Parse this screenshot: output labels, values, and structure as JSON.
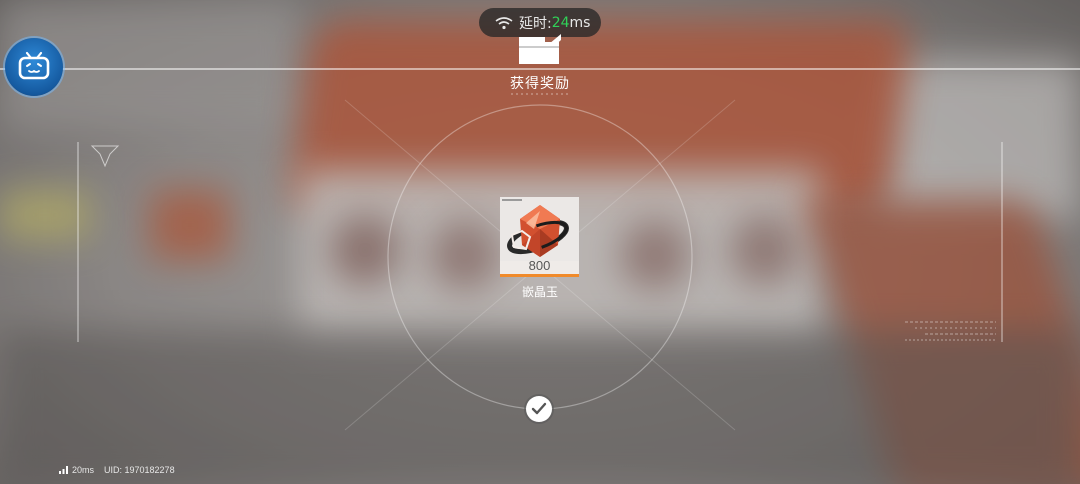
{
  "network": {
    "latency_label": "延时:",
    "latency_value": "24",
    "latency_unit": "ms",
    "footer_ping": "20ms",
    "uid": "UID: 1970182278"
  },
  "reward": {
    "title": "获得奖励",
    "item": {
      "name": "嵌晶玉",
      "count": "800"
    }
  },
  "icons": {
    "wifi": "wifi-icon",
    "bilibili": "bilibili-tv-icon",
    "reward_box": "reward-box-icon",
    "confirm": "checkmark-icon",
    "signal": "signal-bars-icon"
  },
  "colors": {
    "latency_good": "#30d158",
    "rarity_bar": "#f08a2a",
    "bili_blue": "#1f70c1"
  }
}
